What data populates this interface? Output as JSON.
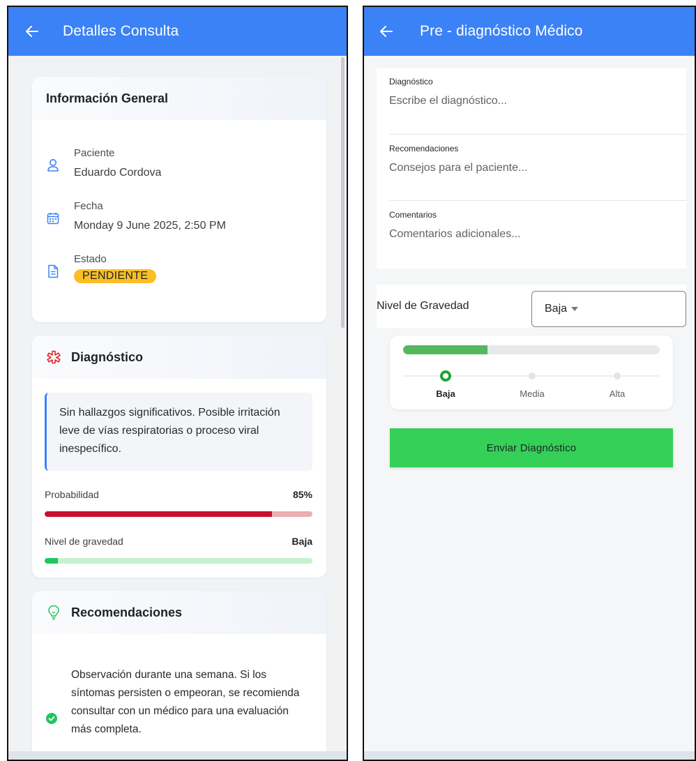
{
  "left_screen": {
    "appbar": {
      "title": "Detalles Consulta"
    },
    "info_card": {
      "title": "Información General",
      "patient": {
        "label": "Paciente",
        "value": "Eduardo Cordova"
      },
      "date": {
        "label": "Fecha",
        "value": "Monday 9 June 2025, 2:50 PM"
      },
      "status": {
        "label": "Estado",
        "value": "PENDIENTE"
      }
    },
    "diagnosis_card": {
      "title": "Diagnóstico",
      "text": "Sin hallazgos significativos. Posible irritación leve de vías respiratorias o proceso viral inespecífico.",
      "probability": {
        "label": "Probabilidad",
        "value": "85%",
        "fraction": 0.85
      },
      "severity": {
        "label": "Nivel de gravedad",
        "value": "Baja",
        "fraction": 0.05
      }
    },
    "recommendations_card": {
      "title": "Recomendaciones",
      "text": "Observación durante una semana. Si los síntomas persisten o empeoran, se recomienda consultar con un médico para una evaluación más completa."
    }
  },
  "right_screen": {
    "appbar": {
      "title": "Pre - diagnóstico Médico"
    },
    "fields": {
      "diagnosis": {
        "label": "Diagnóstico",
        "placeholder": "Escribe el diagnóstico..."
      },
      "recommendations": {
        "label": "Recomendaciones",
        "placeholder": "Consejos para el paciente..."
      },
      "comments": {
        "label": "Comentarios",
        "placeholder": "Comentarios adicionales..."
      }
    },
    "severity": {
      "label": "Nivel de Gravedad",
      "selected": "Baja",
      "levels": [
        "Baja",
        "Media",
        "Alta"
      ],
      "progress_fraction": 0.33
    },
    "submit_label": "Enviar Diagnóstico"
  },
  "colors": {
    "appbar": "#3b82f6",
    "badge": "#fbbf24",
    "probability_fill": "#c8102e",
    "probability_track": "#eaaeb4",
    "severity_fill": "#22c55e",
    "severity_track": "#c6f0cf",
    "submit": "#34d058",
    "diagnosis_icon": "#dc2626",
    "recommendation_icon": "#22c55e"
  }
}
